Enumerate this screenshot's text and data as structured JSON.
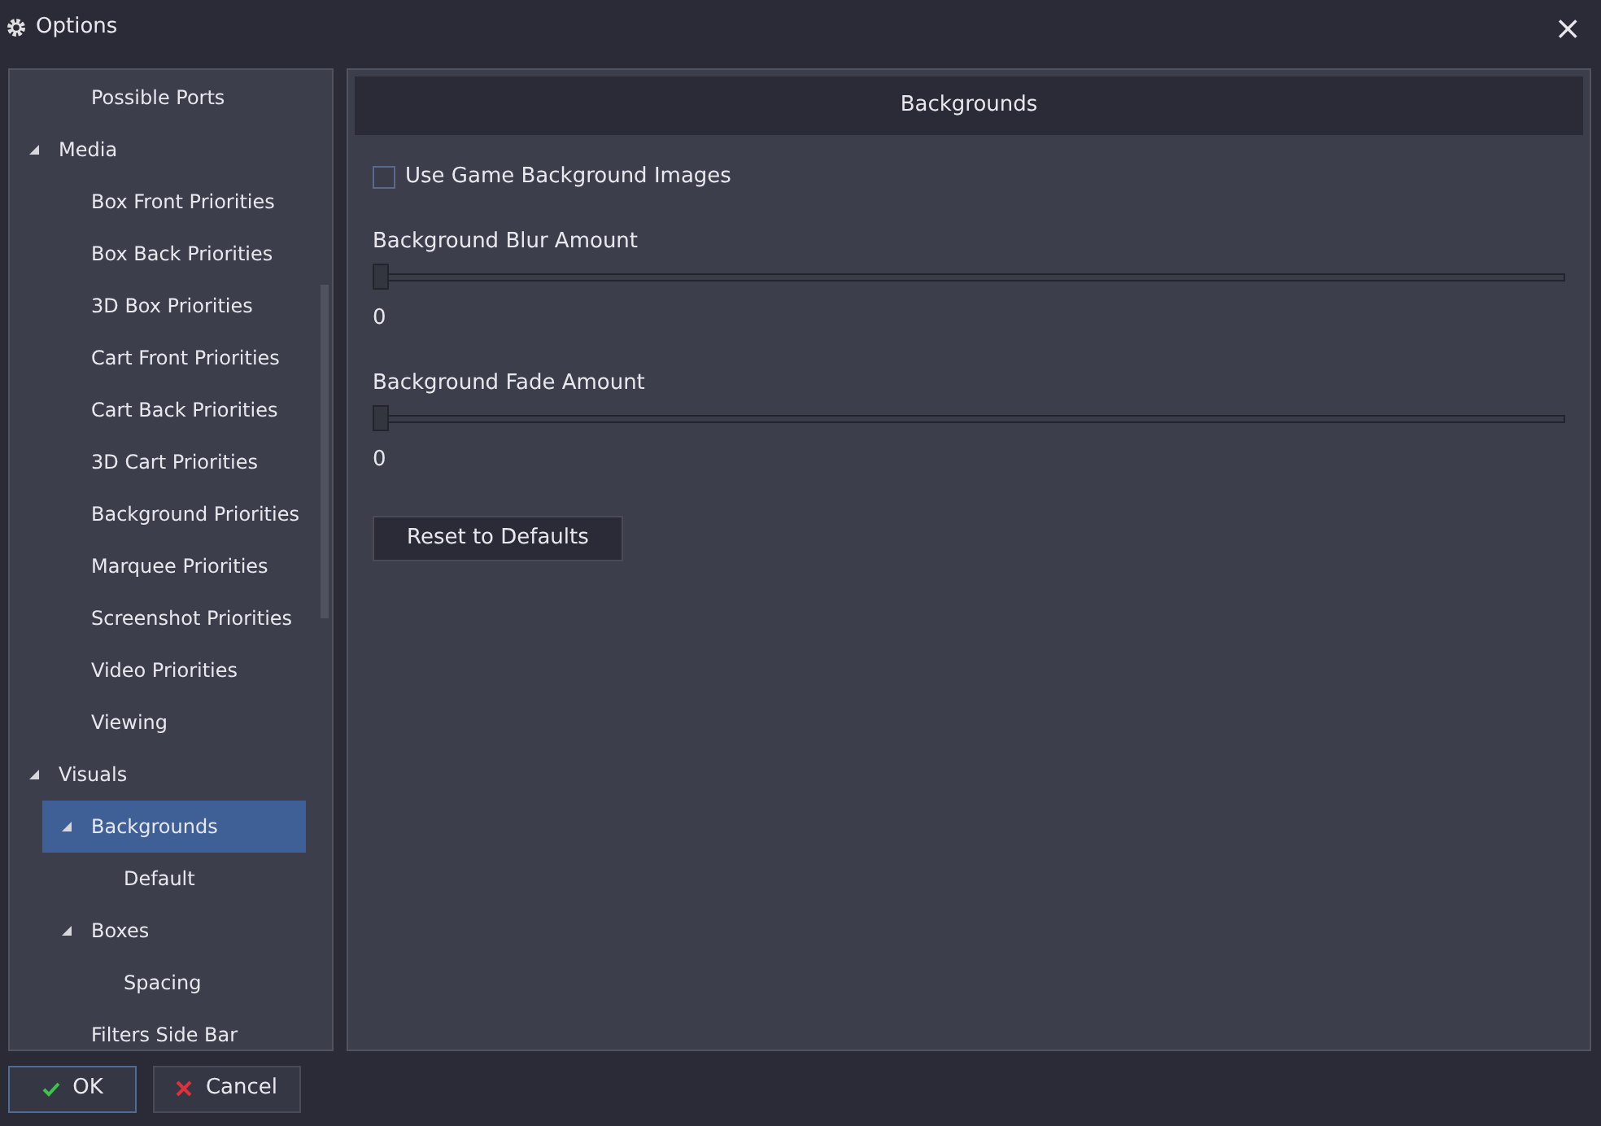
{
  "window": {
    "title": "Options",
    "close": "×"
  },
  "tree": {
    "continued": [
      {
        "label": "Possible Ports",
        "selected": false
      }
    ],
    "items": [
      {
        "label": "Media",
        "expanded": true,
        "selected": false,
        "children": [
          {
            "label": "Box Front Priorities",
            "selected": false
          },
          {
            "label": "Box Back Priorities",
            "selected": false
          },
          {
            "label": "3D Box Priorities",
            "selected": false
          },
          {
            "label": "Cart Front Priorities",
            "selected": false
          },
          {
            "label": "Cart Back Priorities",
            "selected": false
          },
          {
            "label": "3D Cart Priorities",
            "selected": false
          },
          {
            "label": "Background Priorities",
            "selected": false
          },
          {
            "label": "Marquee Priorities",
            "selected": false
          },
          {
            "label": "Screenshot Priorities",
            "selected": false
          },
          {
            "label": "Video Priorities",
            "selected": false
          },
          {
            "label": "Viewing",
            "selected": false
          }
        ]
      },
      {
        "label": "Visuals",
        "expanded": true,
        "selected": false,
        "children": [
          {
            "label": "Backgrounds",
            "expanded": true,
            "selected": true,
            "children": [
              {
                "label": "Default",
                "selected": false
              }
            ]
          },
          {
            "label": "Boxes",
            "expanded": true,
            "selected": false,
            "children": [
              {
                "label": "Spacing",
                "selected": false
              }
            ]
          },
          {
            "label": "Filters Side Bar",
            "selected": false
          }
        ]
      }
    ]
  },
  "panel": {
    "header": "Backgrounds",
    "checkbox": {
      "label": "Use Game Background Images",
      "checked": false
    },
    "sliders": [
      {
        "label": "Background Blur Amount",
        "level": 0,
        "reading": "0"
      },
      {
        "label": "Background Fade Amount",
        "level": 0,
        "reading": "0"
      }
    ],
    "reset_button": "Reset to Defaults"
  },
  "buttons": [
    {
      "label": "OK",
      "kind": "ok"
    },
    {
      "label": "Cancel",
      "kind": "cancel"
    }
  ]
}
